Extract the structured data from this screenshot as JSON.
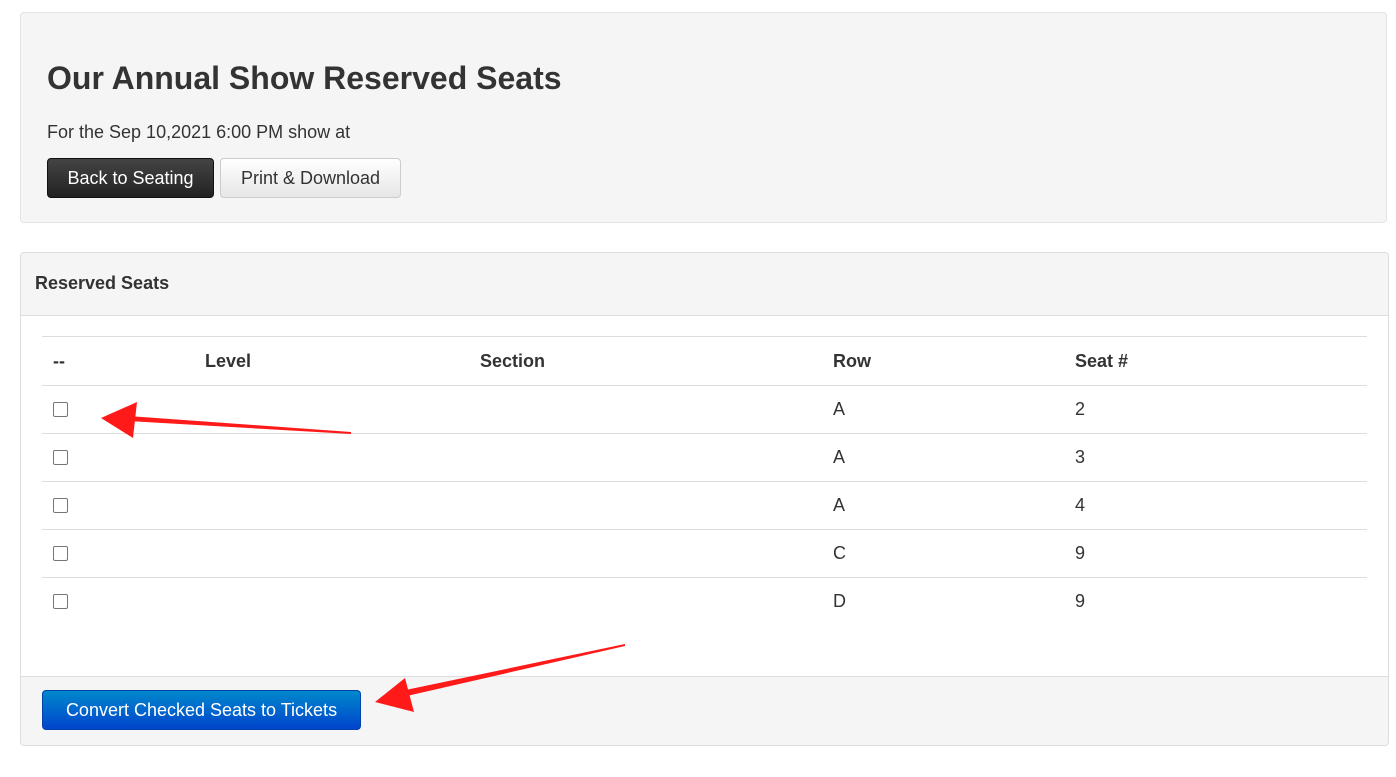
{
  "header": {
    "title": "Our Annual Show Reserved Seats",
    "subtitle": "For the Sep 10,2021 6:00 PM show at",
    "back_button_label": "Back to Seating",
    "print_button_label": "Print & Download"
  },
  "panel": {
    "title": "Reserved Seats",
    "columns": [
      "--",
      "Level",
      "Section",
      "Row",
      "Seat #"
    ],
    "rows": [
      {
        "checked": false,
        "level": "",
        "section": "",
        "row": "A",
        "seat": "2"
      },
      {
        "checked": false,
        "level": "",
        "section": "",
        "row": "A",
        "seat": "3"
      },
      {
        "checked": false,
        "level": "",
        "section": "",
        "row": "A",
        "seat": "4"
      },
      {
        "checked": false,
        "level": "",
        "section": "",
        "row": "C",
        "seat": "9"
      },
      {
        "checked": false,
        "level": "",
        "section": "",
        "row": "D",
        "seat": "9"
      }
    ],
    "convert_button_label": "Convert Checked Seats to Tickets"
  },
  "colors": {
    "annotation_arrow": "#ff1a1a",
    "primary_button": "#0066cc",
    "dark_button": "#222222"
  }
}
